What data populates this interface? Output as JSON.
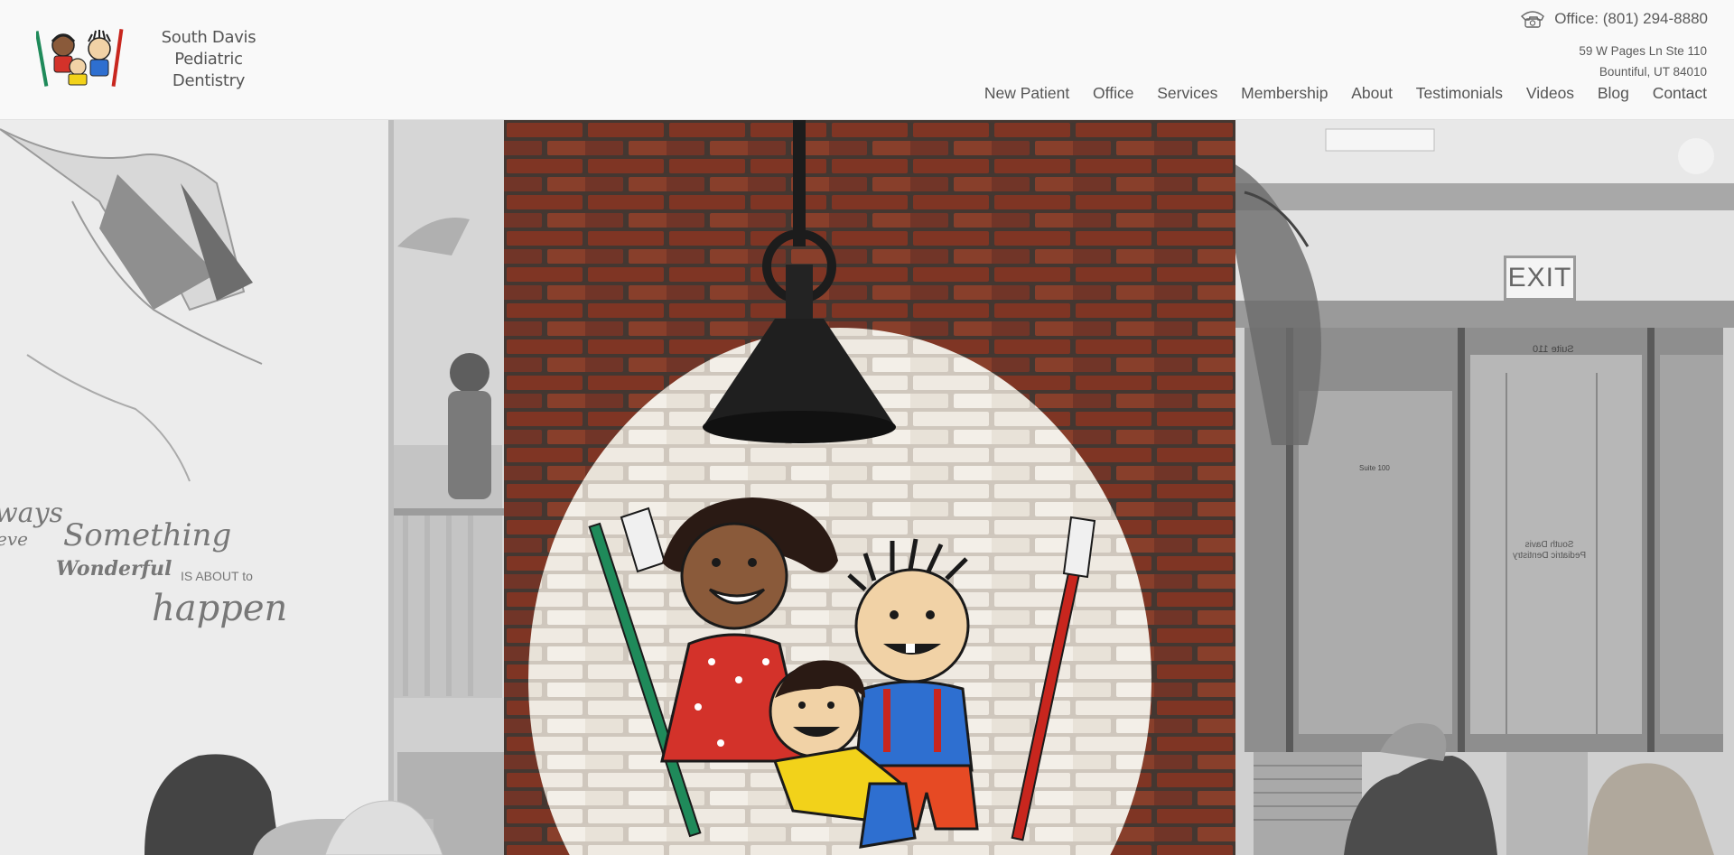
{
  "brand": {
    "name_line1": "South Davis Pediatric",
    "name_line2": "Dentistry"
  },
  "header": {
    "phone_label": "Office: (801) 294-8880",
    "address_line1": "59 W Pages Ln Ste 110",
    "address_line2": "Bountiful, UT 84010"
  },
  "nav": [
    {
      "label": "New Patient"
    },
    {
      "label": "Office"
    },
    {
      "label": "Services"
    },
    {
      "label": "Membership"
    },
    {
      "label": "About"
    },
    {
      "label": "Testimonials"
    },
    {
      "label": "Videos"
    },
    {
      "label": "Blog"
    },
    {
      "label": "Contact"
    }
  ],
  "hero": {
    "left_wall_text": {
      "line1": "ways",
      "line2": "eve",
      "line3": "Something",
      "line4": "Wonderful",
      "line5": "IS ABOUT to",
      "line6": "happen"
    },
    "exit_sign": "EXIT",
    "suite_sign_mirrored": "Suite 110",
    "suite_door_label": "Suite 100",
    "door_logo_mirrored_line1": "South Davis",
    "door_logo_mirrored_line2": "Pediatric Dentistry"
  },
  "colors": {
    "header_bg": "#f9f9f9",
    "nav_text": "#555555",
    "brick_red": "#8a3a28",
    "toothbrush_green": "#1f8a5a",
    "toothbrush_red": "#c8261e",
    "shirt_yellow": "#f2d21a",
    "shirt_blue": "#2e6fd0",
    "dress_red": "#d3322a"
  }
}
